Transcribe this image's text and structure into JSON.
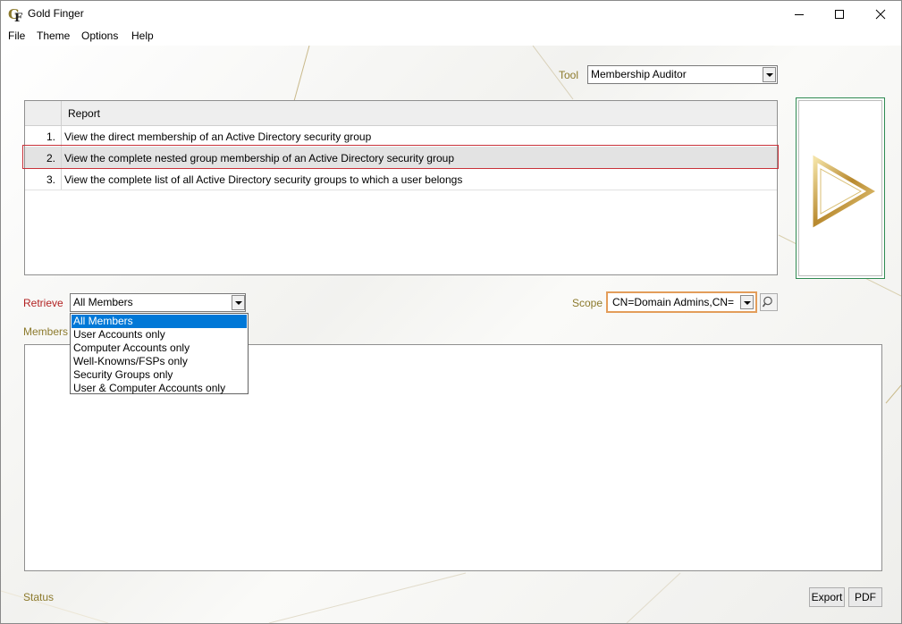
{
  "window": {
    "title": "Gold Finger",
    "logo_text": "GF"
  },
  "menu": {
    "items": [
      "File",
      "Theme",
      "Options",
      "Help"
    ]
  },
  "tool": {
    "label": "Tool",
    "selected": "Membership Auditor"
  },
  "report_table": {
    "header": "Report",
    "rows": [
      {
        "num": "1.",
        "text": "View the direct membership of an Active Directory security group"
      },
      {
        "num": "2.",
        "text": "View the complete nested group membership of an Active Directory security group"
      },
      {
        "num": "3.",
        "text": "View the complete list of all Active Directory security groups to which a user belongs"
      }
    ],
    "selected_row": 2
  },
  "retrieve": {
    "label": "Retrieve",
    "selected": "All Members",
    "options": [
      "All Members",
      "User Accounts only",
      "Computer Accounts only",
      "Well-Knowns/FSPs only",
      "Security Groups only",
      "User & Computer Accounts only"
    ]
  },
  "scope": {
    "label": "Scope",
    "value": "CN=Domain Admins,CN="
  },
  "members": {
    "label": "Members"
  },
  "status": {
    "label": "Status"
  },
  "buttons": {
    "export": "Export",
    "pdf": "PDF"
  },
  "colors": {
    "gold": "#8c7a2c",
    "retrieve_label": "#b22222",
    "selection_blue": "#0078d7",
    "selected_outline": "#c8323a",
    "run_border": "#2f8a52"
  },
  "icons": [
    "app-logo-icon",
    "minimize-icon",
    "maximize-icon",
    "close-icon",
    "play-icon",
    "search-icon",
    "chevron-down-icon"
  ]
}
